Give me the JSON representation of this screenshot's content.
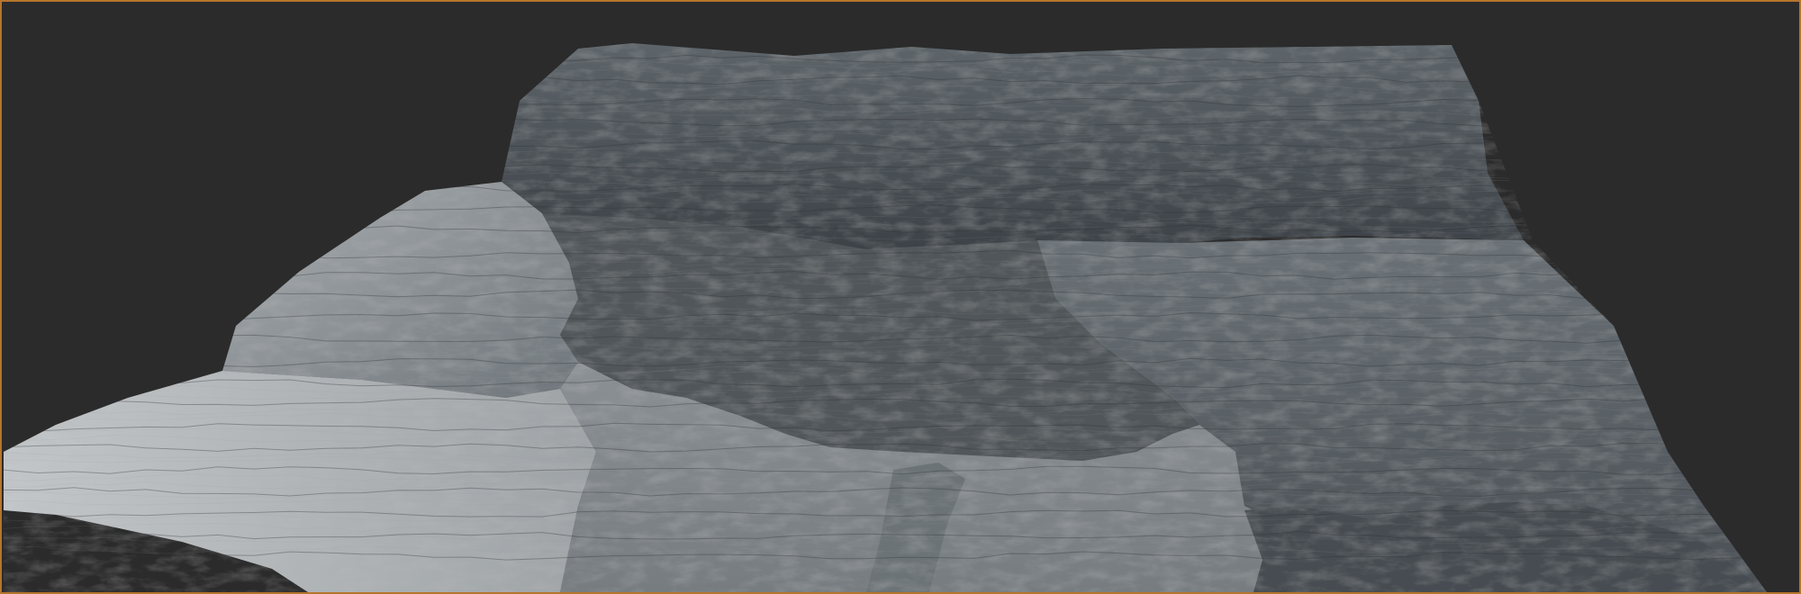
{
  "scene": {
    "kind": "3d-terrain-render",
    "colors": {
      "background": "#2b2b2b",
      "frame_border": "#b5752c",
      "lit_rock": "#b9bdbf",
      "mid_rock": "#6d7479",
      "shadow_rock": "#3e4449",
      "flat_ground": "#7e8488",
      "flat_ground_far": "#8a9094"
    }
  }
}
